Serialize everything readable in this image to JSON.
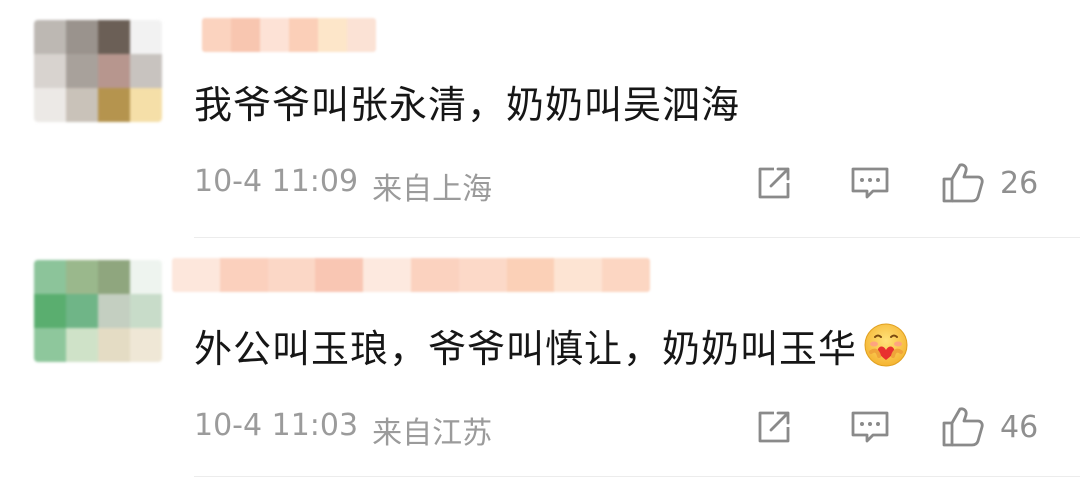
{
  "comments": [
    {
      "text": "我爷爷叫张永清，奶奶叫吴泗海",
      "time": "10-4 11:09",
      "location": "来自上海",
      "likes": "26",
      "avatar_colors": [
        "#bdb8b3",
        "#9a938d",
        "#6b5f56",
        "#f2f2f2",
        "#d8d3cf",
        "#a8a19b",
        "#b7968e",
        "#c8c3bf",
        "#ece9e6",
        "#c9c2b9",
        "#b5944e",
        "#f5dfa8"
      ],
      "username_colors": [
        "#fbd3bf",
        "#f8c6b0",
        "#fde2d6",
        "#fbcfb8",
        "#fde6c9",
        "#fbe2d5"
      ]
    },
    {
      "text": "外公叫玉琅，爷爷叫慎让，奶奶叫玉华",
      "time": "10-4 11:03",
      "location": "来自江苏",
      "likes": "46",
      "avatar_colors": [
        "#8cc49a",
        "#9ab88c",
        "#8fa67e",
        "#eef4ef",
        "#5aae6f",
        "#6fb587",
        "#c4cfc1",
        "#c8dcc9",
        "#8ec79c",
        "#cfe2c8",
        "#e4dcc4",
        "#efe7d6"
      ],
      "username_colors": [
        "#fde7dc",
        "#fbd0bd",
        "#fbd7c6",
        "#f9c6b3",
        "#fde9df",
        "#fbd2bf",
        "#fcd9c8",
        "#fbd0b7",
        "#fde4d3",
        "#fcd6c2"
      ]
    }
  ],
  "icons": {
    "share": "share-icon",
    "reply": "comment-icon",
    "like": "thumbs-up-icon",
    "emoji": "hugging-face-emoji"
  },
  "colors": {
    "text": "#161616",
    "meta": "#9b9b9b",
    "icon": "#8a8a8a",
    "divider": "#ececec"
  }
}
